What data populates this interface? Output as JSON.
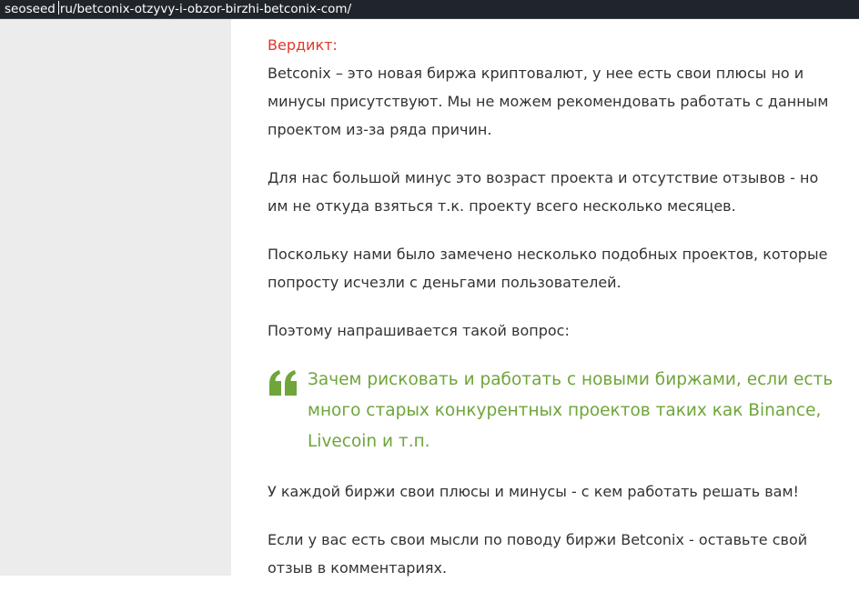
{
  "address_bar": {
    "host": "seoseed",
    "path": "ru/betconix-otzyvy-i-obzor-birzhi-betconix-com/"
  },
  "article": {
    "verdict_title": "Вердикт:",
    "paragraph1": "Betconix – это новая биржа криптовалют, у нее есть свои плюсы но и минусы присутствуют. Мы не можем рекомендовать работать с данным проектом из-за ряда причин.",
    "paragraph2": "Для нас большой минус это возраст проекта и отсутствие отзывов - но им не откуда взяться т.к. проекту всего несколько месяцев.",
    "paragraph3": "Поскольку нами было замечено несколько подобных проектов, которые попросту исчезли с деньгами пользователей.",
    "paragraph4": "Поэтому напрашивается такой вопрос:",
    "quote": "Зачем рисковать и работать с новыми биржами, если есть много старых конкурентных проектов таких как Binance, Livecoin и т.п.",
    "paragraph5": "У каждой биржи свои плюсы и минусы - с кем работать решать вам!",
    "paragraph6": "Если у вас есть свои мысли по поводу биржи Betconix - оставьте свой отзыв в комментариях."
  },
  "colors": {
    "verdict_red": "#e0372b",
    "quote_green": "#6fa53a",
    "body_text": "#333333",
    "sidebar_bg": "#ececec",
    "address_bar_bg": "#1f252b"
  },
  "icons": {
    "quote": "quote-open-icon"
  }
}
